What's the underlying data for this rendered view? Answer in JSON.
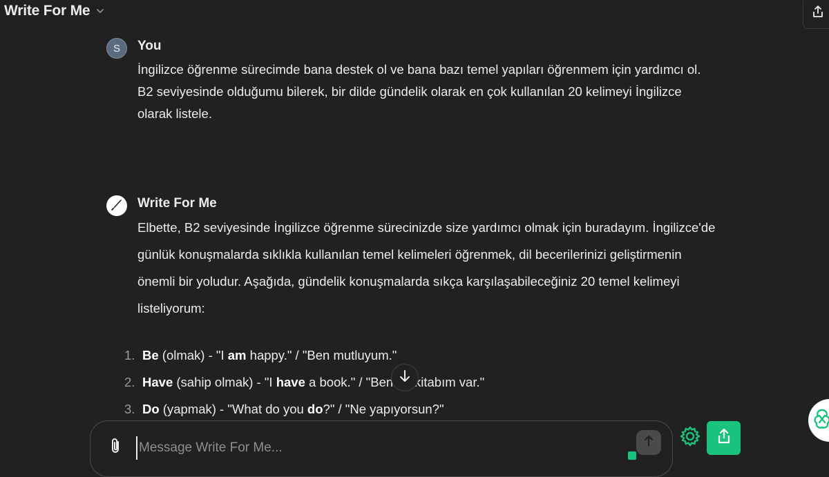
{
  "header": {
    "title": "Write For Me",
    "dropdown_icon": "chevron-down-icon",
    "share_icon": "share-icon"
  },
  "user_message": {
    "avatar_letter": "S",
    "author": "You",
    "text": "İngilizce öğrenme sürecimde bana destek ol ve bana bazı temel yapıları öğrenmem için yardımcı ol. B2 seviyesinde olduğumu bilerek, bir dilde gündelik olarak en çok kullanılan 20 kelimeyi İngilizce olarak listele."
  },
  "bot_message": {
    "avatar_icon": "quill-icon",
    "author": "Write For Me",
    "intro": "Elbette, B2 seviyesinde İngilizce öğrenme sürecinizde size yardımcı olmak için buradayım. İngilizce'de günlük konuşmalarda sıklıkla kullanılan temel kelimeleri öğrenmek, dil becerilerinizi geliştirmenin önemli bir yoludur. Aşağıda, gündelik konuşmalarda sıkça karşılaşabileceğiniz 20 temel kelimeyi listeliyorum:",
    "list": [
      {
        "num": "1.",
        "word": "Be",
        "meaning": " (olmak) - \"I ",
        "ex_bold": "am",
        "rest": " happy.\" / \"Ben mutluyum.\""
      },
      {
        "num": "2.",
        "word": "Have",
        "meaning": " (sahip olmak) - \"I ",
        "ex_bold": "have",
        "rest": " a book.\" / \"Ben bir kitabım var.\""
      },
      {
        "num": "3.",
        "word": "Do",
        "meaning": " (yapmak) - \"What do you ",
        "ex_bold": "do",
        "rest": "?\" / \"Ne yapıyorsun?\""
      }
    ]
  },
  "composer": {
    "placeholder": "Message Write For Me...",
    "attach_icon": "paperclip-icon",
    "send_icon": "arrow-up-icon"
  },
  "floating": {
    "scroll_icon": "arrow-down-icon",
    "gear_icon": "gear-icon",
    "share_icon": "share-icon",
    "badge_icon": "openai-logo-icon"
  },
  "colors": {
    "background": "#212121",
    "accent": "#19c37d",
    "text": "#ececec"
  }
}
